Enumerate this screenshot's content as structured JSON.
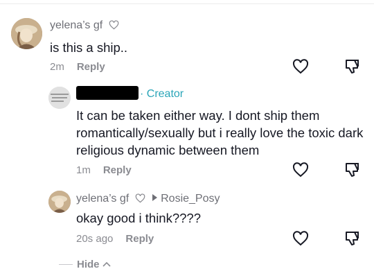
{
  "comments": [
    {
      "username": "yelena’s gf",
      "text": "is this a ship..",
      "time": "2m",
      "reply_label": "Reply"
    },
    {
      "creator_label": "· Creator",
      "text": "It can be taken either way. I dont ship them romantically/sexually but i really love the toxic dark religious dynamic between them",
      "time": "1m",
      "reply_label": "Reply"
    },
    {
      "username": "yelena’s gf",
      "reply_to": "Rosie_Posy",
      "text": "okay good i think????",
      "time": "20s ago",
      "reply_label": "Reply"
    }
  ],
  "hide_label": "Hide",
  "icons": {
    "like": "heart-outline-icon",
    "dislike": "thumbs-down-icon",
    "collapse": "chevron-up-icon"
  },
  "colors": {
    "creator": "#2aa5b8",
    "muted": "#8a8b91",
    "text": "#161823"
  }
}
